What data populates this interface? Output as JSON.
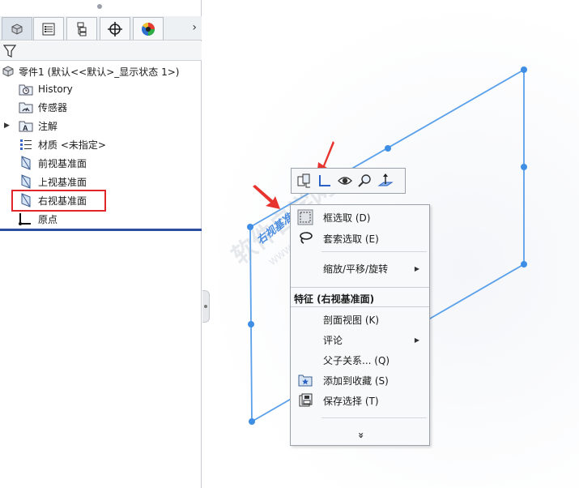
{
  "feature_tree": {
    "tabs": [
      {
        "icon": "feature-manager-icon",
        "active": true
      },
      {
        "icon": "property-manager-icon",
        "active": false
      },
      {
        "icon": "configuration-manager-icon",
        "active": false
      },
      {
        "icon": "dimxpert-icon",
        "active": false
      },
      {
        "icon": "display-manager-icon",
        "active": false
      }
    ],
    "tab_more": "›",
    "root_label": "零件1  (默认<<默认>_显示状态 1>)",
    "items": [
      {
        "label": "History",
        "icon": "history-folder-icon"
      },
      {
        "label": "传感器",
        "icon": "sensor-folder-icon"
      },
      {
        "label": "注解",
        "icon": "annotations-folder-icon",
        "expandable": true
      },
      {
        "label": "材质 <未指定>",
        "icon": "material-icon"
      },
      {
        "label": "前视基准面",
        "icon": "plane-icon"
      },
      {
        "label": "上视基准面",
        "icon": "plane-icon"
      },
      {
        "label": "右视基准面",
        "icon": "plane-icon",
        "highlighted": true
      },
      {
        "label": "原点",
        "icon": "origin-icon"
      }
    ]
  },
  "viewport": {
    "plane_label": "右视基准面",
    "watermark": "软件自学网",
    "watermark_sub": "WWW.RJZXW.COM"
  },
  "context_toolbar": {
    "buttons": [
      {
        "icon": "show-hide-icon"
      },
      {
        "icon": "sketch-icon"
      },
      {
        "icon": "hide-eye-icon"
      },
      {
        "icon": "zoom-to-selection-icon"
      },
      {
        "icon": "normal-to-icon"
      }
    ]
  },
  "context_menu": {
    "items_top": [
      {
        "label": "框选取 (D)",
        "icon": "box-select-icon"
      },
      {
        "label": "套索选取 (E)",
        "icon": "lasso-select-icon"
      },
      {
        "label": "缩放/平移/旋转",
        "submenu": true
      }
    ],
    "section_header": "特征 (右视基准面)",
    "items_bottom": [
      {
        "label": "剖面视图 (K)"
      },
      {
        "label": "评论",
        "submenu": true
      },
      {
        "label": "父子关系... (Q)"
      },
      {
        "label": "添加到收藏 (S)",
        "icon": "add-favorite-icon"
      },
      {
        "label": "保存选择 (T)",
        "icon": "save-selection-icon"
      }
    ],
    "more_glyph": "»"
  },
  "colors": {
    "plane_edge": "#5aa0ea",
    "highlight_box": "#e0262a",
    "arrow": "#e8342e",
    "panel_accent": "#2b4f9e"
  }
}
